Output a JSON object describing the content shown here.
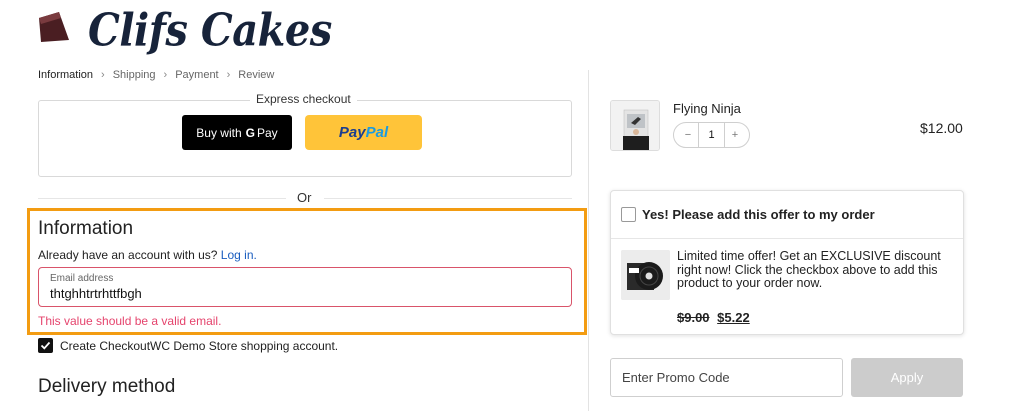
{
  "brand": {
    "name": "Clifs Cakes",
    "logo_icon": "cake-slice-icon"
  },
  "breadcrumb": [
    {
      "label": "Information",
      "active": true
    },
    {
      "label": "Shipping",
      "active": false
    },
    {
      "label": "Payment",
      "active": false
    },
    {
      "label": "Review",
      "active": false
    }
  ],
  "breadcrumb_separator": ">",
  "express": {
    "legend": "Express checkout",
    "gpay_prefix": "Buy with",
    "gpay_g": "G",
    "gpay_suffix": "Pay",
    "paypal_part1": "Pay",
    "paypal_part2": "Pal"
  },
  "or_label": "Or",
  "information": {
    "title": "Information",
    "account_prompt": "Already have an account with us?",
    "login_link": "Log in.",
    "email_label": "Email address",
    "email_value": "thtghhtrtrhttfbgh",
    "email_error": "This value should be a valid email.",
    "create_account_label": "Create CheckoutWC Demo Store shopping account.",
    "create_account_checked": true
  },
  "delivery_title": "Delivery method",
  "cart": {
    "product_name": "Flying Ninja",
    "quantity": "1",
    "minus": "−",
    "plus": "+",
    "price": "$12.00"
  },
  "offer": {
    "heading": "Yes! Please add this offer to my order",
    "description": "Limited time offer! Get an EXCLUSIVE discount right now! Click the checkbox above to add this product to your order now.",
    "old_price": "$9.00",
    "new_price": "$5.22",
    "checked": false
  },
  "promo": {
    "placeholder": "Enter Promo Code",
    "apply_label": "Apply"
  },
  "colors": {
    "highlight": "#f39c12",
    "error": "#e5446d",
    "link": "#1a5dbf",
    "paypal_yellow": "#ffc439",
    "brand_navy": "#17233a"
  }
}
